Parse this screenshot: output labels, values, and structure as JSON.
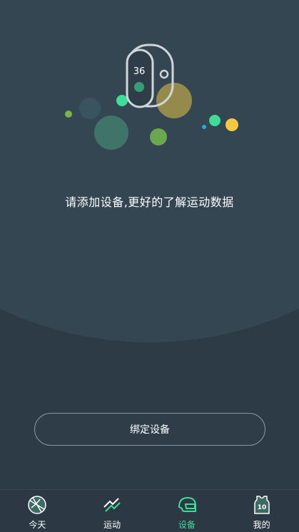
{
  "device_page": {
    "prompt_text": "请添加设备,更好的了解运动数据",
    "band_display_number": "36",
    "bind_button_label": "绑定设备"
  },
  "tabbar": {
    "tabs": [
      {
        "label": "今天",
        "icon": "basketball-icon",
        "active": false
      },
      {
        "label": "运动",
        "icon": "run-icon",
        "active": false
      },
      {
        "label": "设备",
        "icon": "helmet-icon",
        "active": true
      },
      {
        "label": "我的",
        "icon": "jersey-icon",
        "active": false
      }
    ],
    "jersey_number": "10"
  },
  "colors": {
    "accent": "#3ddc97",
    "background": "#2d3b47"
  }
}
